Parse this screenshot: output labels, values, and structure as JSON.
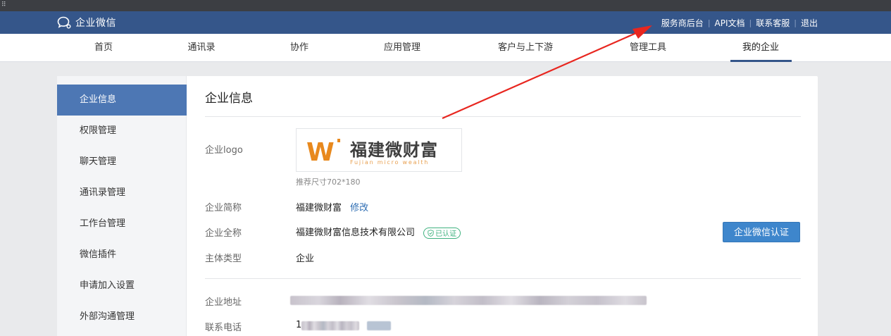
{
  "topbar": {
    "brand_name": "企业微信",
    "links": [
      "服务商后台",
      "API文档",
      "联系客服",
      "退出"
    ]
  },
  "nav": {
    "items": [
      "首页",
      "通讯录",
      "协作",
      "应用管理",
      "客户与上下游",
      "管理工具",
      "我的企业"
    ],
    "active": "我的企业"
  },
  "sidebar": {
    "items": [
      "企业信息",
      "权限管理",
      "聊天管理",
      "通讯录管理",
      "工作台管理",
      "微信插件",
      "申请加入设置",
      "外部沟通管理"
    ],
    "active": "企业信息"
  },
  "content": {
    "title": "企业信息",
    "logo_label": "企业logo",
    "logo": {
      "mark": "W",
      "text_cn": "福建微财富",
      "text_en": "Fujian micro wealth"
    },
    "logo_hint": "推荐尺寸702*180",
    "short_name_label": "企业简称",
    "short_name_value": "福建微财富",
    "short_name_edit": "修改",
    "full_name_label": "企业全称",
    "full_name_value": "福建微财富信息技术有限公司",
    "verified_badge": "已认证",
    "verify_button": "企业微信认证",
    "type_label": "主体类型",
    "type_value": "企业",
    "address_label": "企业地址",
    "phone_label": "联系电话",
    "phone_visible_prefix": "1"
  },
  "colors": {
    "topbar": "#35568a",
    "sidebar_active": "#4d77b4",
    "button": "#3e86cc",
    "badge": "#3fb27f",
    "link": "#2f6eb3",
    "arrow": "#e8261f"
  }
}
